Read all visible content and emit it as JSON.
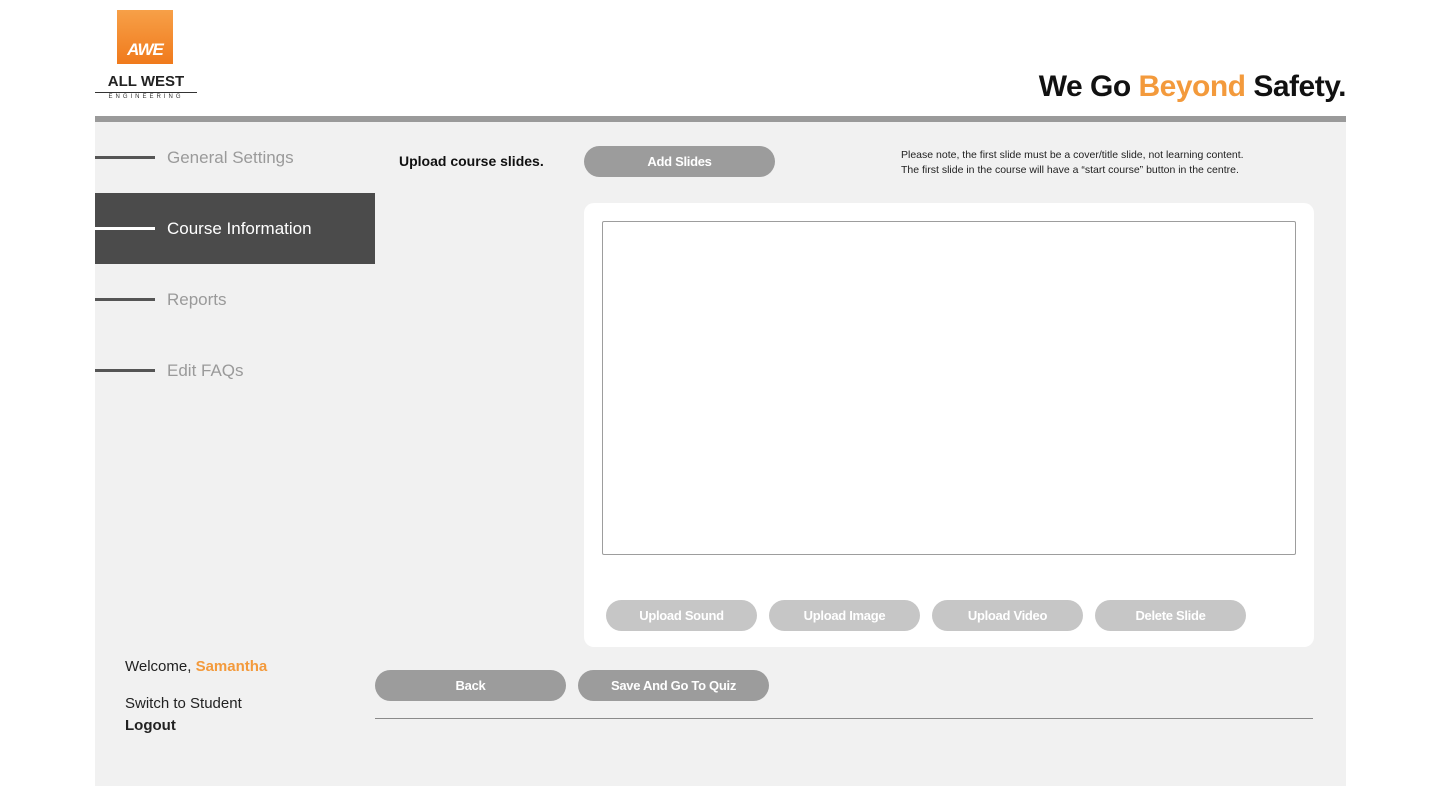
{
  "header": {
    "logo_mark": "AWE",
    "logo_name": "ALL WEST",
    "logo_sub": "ENGINEERING",
    "tagline_pre": "We Go ",
    "tagline_accent": "Beyond",
    "tagline_post": " Safety."
  },
  "sidebar": {
    "items": [
      {
        "label": "General Settings",
        "active": false
      },
      {
        "label": "Course Information",
        "active": true
      },
      {
        "label": "Reports",
        "active": false
      },
      {
        "label": "Edit FAQs",
        "active": false
      }
    ],
    "welcome_prefix": "Welcome, ",
    "username": "Samantha",
    "switch_label": "Switch to Student",
    "logout_label": "Logout"
  },
  "upload": {
    "label": "Upload course slides.",
    "add_slides_label": "Add Slides",
    "note_line1": "Please note, the first slide must be a cover/title slide, not learning content.",
    "note_line2": "The first slide in the course will have a “start course” button in the centre."
  },
  "slide_tools": {
    "upload_sound": "Upload Sound",
    "upload_image": "Upload Image",
    "upload_video": "Upload Video",
    "delete_slide": "Delete Slide"
  },
  "actions": {
    "back_label": "Back",
    "save_label": "Save And Go To Quiz"
  },
  "colors": {
    "accent": "#f39a3c",
    "active_nav": "#4b4b4b",
    "button": "#9c9c9c",
    "button_light": "#c6c6c6"
  }
}
